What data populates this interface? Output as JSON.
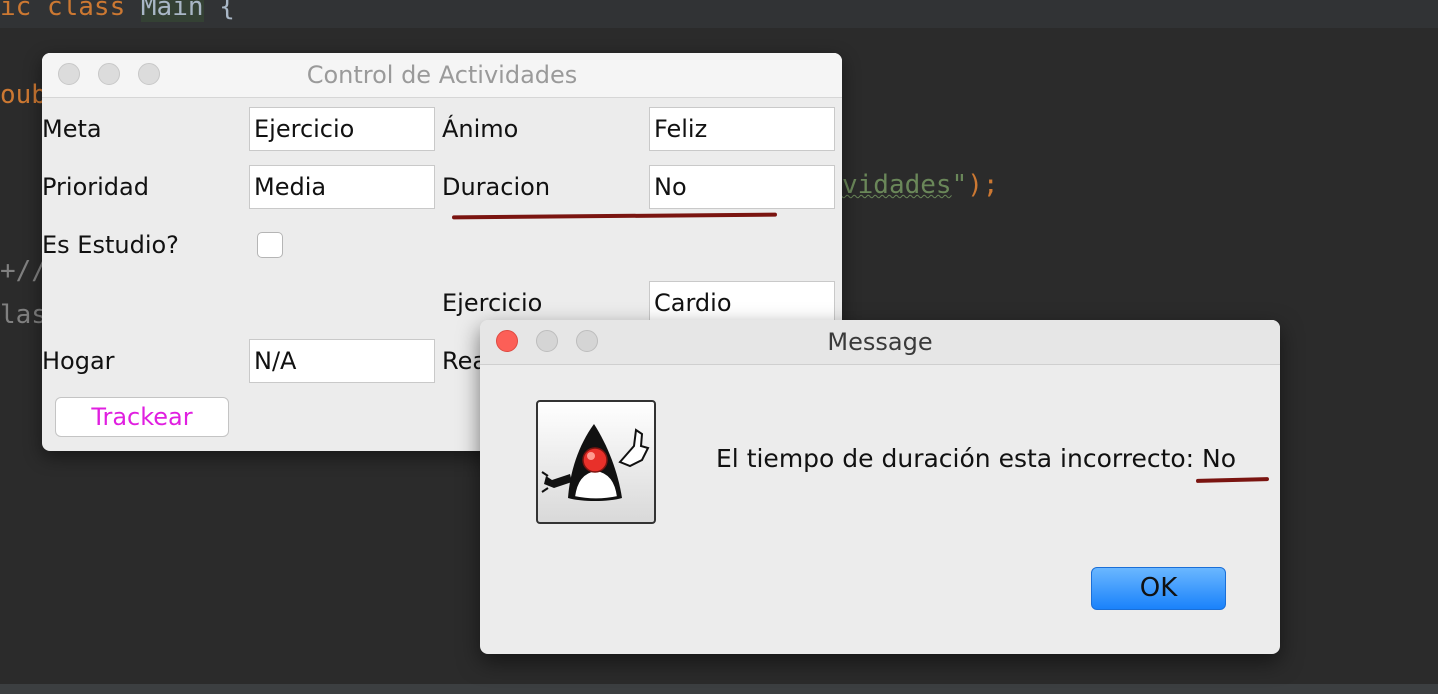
{
  "editor": {
    "line1": {
      "kw_public_tail": "ic",
      "kw_class": "class",
      "class_name": "Main",
      "brace": "{"
    },
    "line2": {
      "fragment": "oub"
    },
    "line3": {
      "string_tail": "vidades",
      "quote": "\"",
      "close": ");"
    },
    "line4": {
      "fragment": "+//"
    },
    "line5": {
      "fragment": "las"
    }
  },
  "main_window": {
    "title": "Control de Actividades",
    "fields": {
      "meta": {
        "label": "Meta",
        "value": "Ejercicio"
      },
      "animo": {
        "label": "Ánimo",
        "value": "Feliz"
      },
      "prioridad": {
        "label": "Prioridad",
        "value": "Media"
      },
      "duracion": {
        "label": "Duracion",
        "value": "No"
      },
      "es_estudio": {
        "label": "Es Estudio?",
        "checked": false
      },
      "ejercicio": {
        "label": "Ejercicio",
        "value": "Cardio"
      },
      "hogar": {
        "label": "Hogar",
        "value": "N/A"
      },
      "rea": {
        "label": "Rea"
      }
    },
    "button_label": "Trackear",
    "button_color": "#e01fe0"
  },
  "message_dialog": {
    "title": "Message",
    "message": "El tiempo de duración esta incorrecto: No",
    "ok_label": "OK",
    "icon": "java-duke-icon"
  },
  "annotation_color": "#7a1410"
}
